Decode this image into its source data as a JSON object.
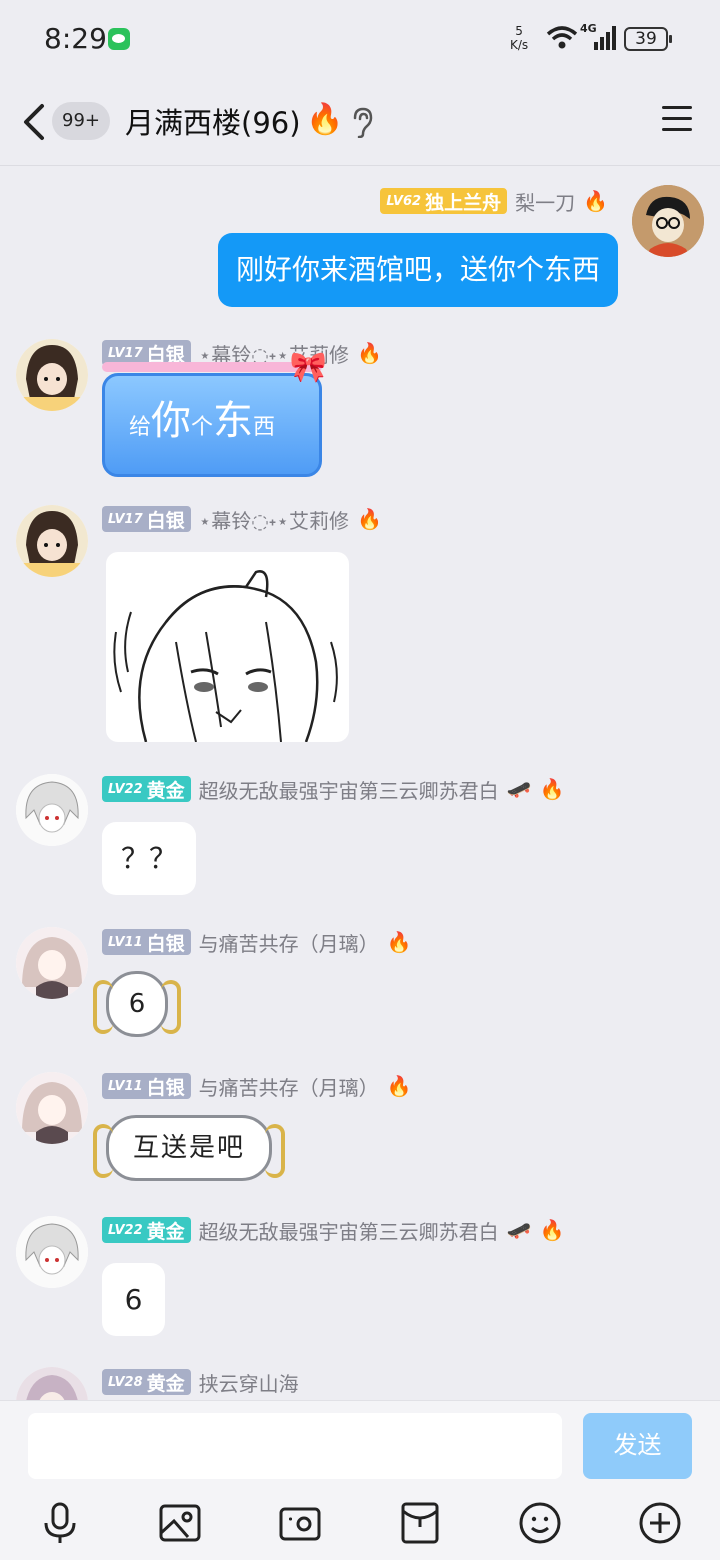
{
  "status_bar": {
    "time": "8:29",
    "net_speed_value": "5",
    "net_speed_unit": "K/s",
    "network": "4G",
    "battery": "39"
  },
  "header": {
    "unread_count": "99+",
    "title": "月满西楼(96)",
    "fire_icon": "🔥"
  },
  "colors": {
    "accent": "#1499f7",
    "level_gold": "#39c9c3",
    "level_silver": "#a8afc7",
    "level_top": "#f6c43b"
  },
  "messages": [
    {
      "side": "right",
      "level": "LV62",
      "rank": "独上兰舟",
      "nickname": "梨一刀",
      "text": "刚好你来酒馆吧，送你个东西"
    },
    {
      "side": "left",
      "level": "LV17",
      "rank": "白银",
      "nickname": "⋆幕铃◌˖⋆艾莉修",
      "gift_text_a": "给",
      "gift_text_b": "你",
      "gift_text_c": "个",
      "gift_text_d": "东",
      "gift_text_e": "西"
    },
    {
      "side": "left",
      "level": "LV17",
      "rank": "白银",
      "nickname": "⋆幕铃◌˖⋆艾莉修",
      "sticker": "manga-girl-sticker"
    },
    {
      "side": "left",
      "level": "LV22",
      "rank": "黄金",
      "nickname": "超级无敌最强宇宙第三云卿苏君白",
      "text": "？？"
    },
    {
      "side": "left",
      "level": "LV11",
      "rank": "白银",
      "nickname": "与痛苦共存（月璃）",
      "text": "6"
    },
    {
      "side": "left",
      "level": "LV11",
      "rank": "白银",
      "nickname": "与痛苦共存（月璃）",
      "text": "互送是吧"
    },
    {
      "side": "left",
      "level": "LV22",
      "rank": "黄金",
      "nickname": "超级无敌最强宇宙第三云卿苏君白",
      "text": "6"
    },
    {
      "side": "left",
      "level": "LV28",
      "rank": "黄金",
      "nickname": "挟云穿山海"
    }
  ],
  "input": {
    "placeholder": "",
    "send_label": "发送"
  },
  "toolbar_icons": [
    "microphone-icon",
    "image-icon",
    "camera-icon",
    "red-packet-icon",
    "emoji-icon",
    "plus-icon"
  ]
}
